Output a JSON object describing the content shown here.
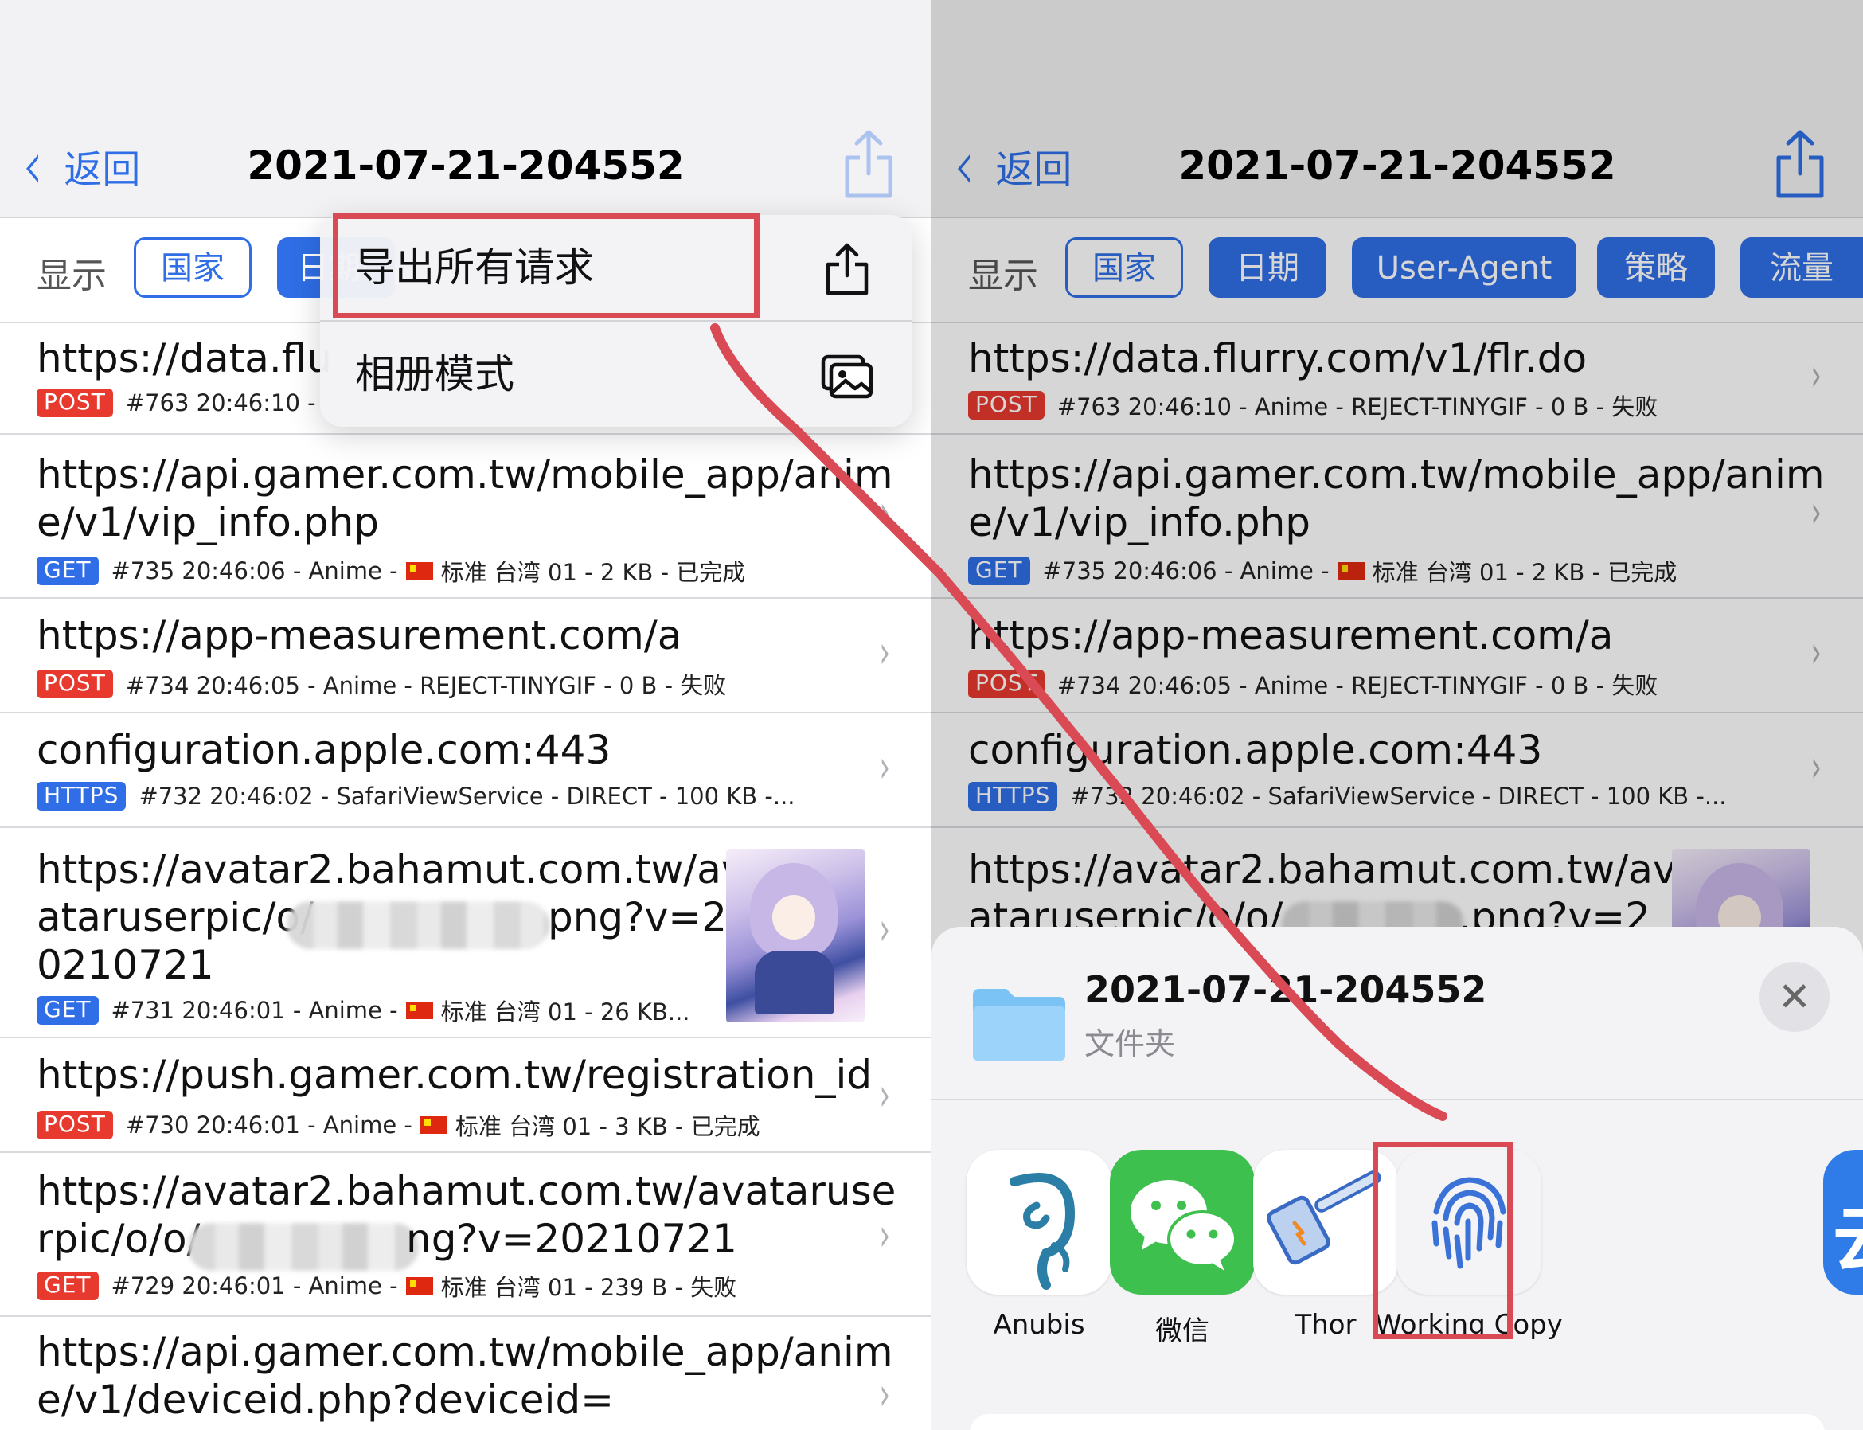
{
  "colors": {
    "accent": "#2f6ee6",
    "post_badge": "#e8392f",
    "annotation_red": "#d94a55",
    "wechat_green": "#3ec04f"
  },
  "left": {
    "nav": {
      "back_label": "返回",
      "title": "2021-07-21-204552",
      "share_icon": "share-icon"
    },
    "filter": {
      "label": "显示",
      "chips": [
        "国家",
        "日期"
      ]
    },
    "menu": {
      "items": [
        {
          "label": "导出所有请求",
          "icon": "share-icon"
        },
        {
          "label": "相册模式",
          "icon": "photos-icon"
        }
      ]
    },
    "rows": [
      {
        "url": "https://data.flu",
        "method": "POST",
        "meta": "#763 20:46:10 -"
      },
      {
        "url_line1": "https://api.gamer.com.tw/mobile_app/anim",
        "url_line2": "e/v1/vip_info.php",
        "method": "GET",
        "meta_pre": "#735 20:46:06 - Anime -",
        "meta_post": "标准 台湾 01 - 2 KB - 已完成"
      },
      {
        "url": "https://app-measurement.com/a",
        "method": "POST",
        "meta": "#734 20:46:05 - Anime - REJECT-TINYGIF - 0 B - 失败"
      },
      {
        "url": "configuration.apple.com:443",
        "method": "HTTPS",
        "meta": "#732 20:46:02 - SafariViewService - DIRECT - 100 KB -..."
      },
      {
        "url_line1": "https://avatar2.bahamut.com.tw/av",
        "url_line2a": "ataruserpic/o/",
        "url_line2b": "png?v=2",
        "url_line3": "0210721",
        "method": "GET",
        "meta_pre": "#731 20:46:01 - Anime -",
        "meta_post": "标准 台湾 01 - 26 KB..."
      },
      {
        "url": "https://push.gamer.com.tw/registration_id",
        "method": "POST",
        "meta_pre": "#730 20:46:01 - Anime -",
        "meta_post": "标准 台湾 01 - 3 KB - 已完成"
      },
      {
        "url_line1": "https://avatar2.bahamut.com.tw/avataruse",
        "url_line2a": "rpic/o/o/",
        "url_line2b": "ng?v=20210721",
        "method": "GET",
        "meta_pre": "#729 20:46:01 - Anime -",
        "meta_post": "标准 台湾 01 - 239 B - 失败"
      },
      {
        "url_line1": "https://api.gamer.com.tw/mobile_app/anim",
        "url_line2": "e/v1/deviceid.php?deviceid="
      }
    ]
  },
  "right": {
    "nav": {
      "back_label": "返回",
      "title": "2021-07-21-204552",
      "share_icon": "share-icon"
    },
    "filter": {
      "label": "显示",
      "chips": [
        "国家",
        "日期",
        "User-Agent",
        "策略",
        "流量"
      ]
    },
    "rows": [
      {
        "url": "https://data.flurry.com/v1/flr.do",
        "method": "POST",
        "meta": "#763 20:46:10 - Anime - REJECT-TINYGIF - 0 B - 失败"
      },
      {
        "url_line1": "https://api.gamer.com.tw/mobile_app/anim",
        "url_line2": "e/v1/vip_info.php",
        "method": "GET",
        "meta_pre": "#735 20:46:06 - Anime -",
        "meta_post": "标准 台湾 01 - 2 KB - 已完成"
      },
      {
        "url": "https://app-measurement.com/a",
        "method": "POST",
        "meta": "#734 20:46:05 - Anime - REJECT-TINYGIF - 0 B - 失败"
      },
      {
        "url": "configuration.apple.com:443",
        "method": "HTTPS",
        "meta": "#732 20:46:02 - SafariViewService - DIRECT - 100 KB -..."
      },
      {
        "url_line1": "https://avatar2.bahamut.com.tw/av",
        "url_line2a": "ataruserpic/o/o/",
        "url_line2b": ".png?v=2"
      }
    ],
    "sheet": {
      "title": "2021-07-21-204552",
      "subtitle": "文件夹",
      "close_icon": "close-icon",
      "apps": [
        {
          "label": "Anubis",
          "icon": "anubis-app-icon"
        },
        {
          "label": "微信",
          "icon": "wechat-app-icon"
        },
        {
          "label": "Thor",
          "icon": "thor-app-icon"
        },
        {
          "label": "Working Copy",
          "icon": "working-copy-app-icon"
        }
      ]
    }
  }
}
